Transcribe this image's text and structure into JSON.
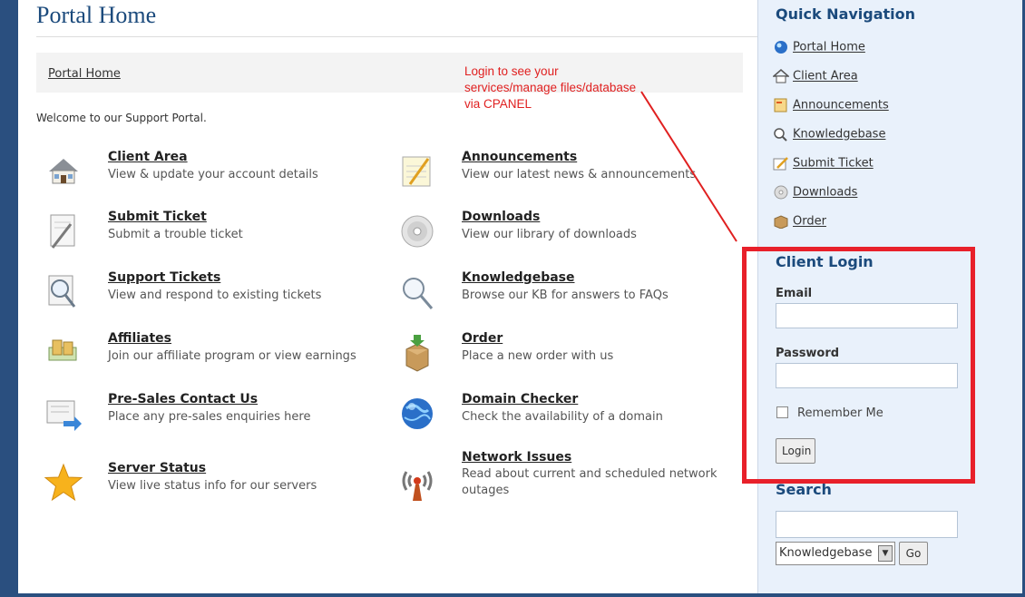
{
  "page": {
    "title": "Portal Home",
    "welcome": "Welcome to our Support Portal."
  },
  "breadcrumb": {
    "label": "Portal Home"
  },
  "annotation": {
    "note": "Login to see your services/manage files/database via CPANEL",
    "color": "#e02020"
  },
  "items": [
    {
      "name": "Client Area",
      "desc": "View & update your account details",
      "icon": "house-icon"
    },
    {
      "name": "Announcements",
      "desc": "View our latest news & announcements",
      "icon": "notepad-icon"
    },
    {
      "name": "Submit Ticket",
      "desc": "Submit a trouble ticket",
      "icon": "pen-paper-icon"
    },
    {
      "name": "Downloads",
      "desc": "View our library of downloads",
      "icon": "disc-icon"
    },
    {
      "name": "Support Tickets",
      "desc": "View and respond to existing tickets",
      "icon": "magnifier-doc-icon"
    },
    {
      "name": "Knowledgebase",
      "desc": "Browse our KB for answers to FAQs",
      "icon": "magnifier-icon"
    },
    {
      "name": "Affiliates",
      "desc": "Join our affiliate program or view earnings",
      "icon": "money-icon"
    },
    {
      "name": "Order",
      "desc": "Place a new order with us",
      "icon": "box-icon"
    },
    {
      "name": "Pre-Sales Contact Us",
      "desc": "Place any pre-sales enquiries here",
      "icon": "mail-arrow-icon"
    },
    {
      "name": "Domain Checker",
      "desc": "Check the availability of a domain",
      "icon": "globe-icon"
    },
    {
      "name": "Server Status",
      "desc": "View live status info for our servers",
      "icon": "star-icon"
    },
    {
      "name": "Network Issues",
      "desc": "Read about current and scheduled network outages",
      "icon": "antenna-icon"
    }
  ],
  "sidebar": {
    "quick_nav_title": "Quick Navigation",
    "nav": [
      {
        "label": "Portal Home",
        "icon": "globe-small-icon"
      },
      {
        "label": "Client Area",
        "icon": "house-small-icon"
      },
      {
        "label": "Announcements",
        "icon": "notepad-small-icon"
      },
      {
        "label": "Knowledgebase",
        "icon": "magnifier-small-icon"
      },
      {
        "label": "Submit Ticket",
        "icon": "pen-small-icon"
      },
      {
        "label": "Downloads",
        "icon": "disc-small-icon"
      },
      {
        "label": "Order",
        "icon": "box-small-icon"
      }
    ],
    "login": {
      "title": "Client Login",
      "email_label": "Email",
      "email_value": "",
      "password_label": "Password",
      "password_value": "",
      "remember_label": "Remember Me",
      "button_label": "Login"
    },
    "search": {
      "title": "Search",
      "value": "",
      "select_value": "Knowledgebase",
      "go_label": "Go"
    }
  },
  "colors": {
    "accent": "#1b4a7c",
    "frame": "#2a4f7f",
    "highlight_border": "#e8202a",
    "sidebar_bg": "#e9f1fb"
  }
}
